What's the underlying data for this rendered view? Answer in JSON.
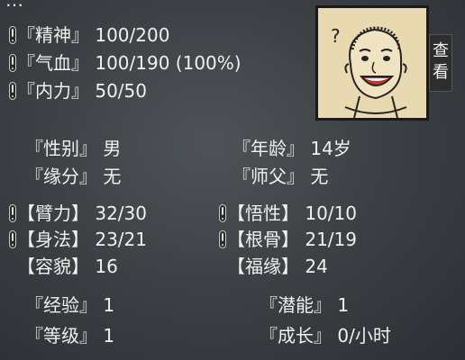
{
  "top_text": "…",
  "vitals": [
    {
      "label": "『精神』",
      "value": "100/200",
      "warn": true
    },
    {
      "label": "『气血』",
      "value": "100/190 (100%)",
      "warn": true
    },
    {
      "label": "『内力』",
      "value": "50/50",
      "warn": true
    }
  ],
  "info": {
    "gender_label": "『性别』",
    "gender": "男",
    "age_label": "『年龄』",
    "age": "14岁",
    "fate_label": "『缘分』",
    "fate": "无",
    "master_label": "『师父』",
    "master": "无"
  },
  "attributes": {
    "strength_label": "【臂力】",
    "strength": "32/30",
    "agility_label": "【身法】",
    "agility": "23/21",
    "looks_label": "【容貌】",
    "looks": "16",
    "insight_label": "【悟性】",
    "insight": "10/10",
    "bones_label": "【根骨】",
    "bones": "21/19",
    "luck_label": "【福缘】",
    "luck": "24"
  },
  "progress": {
    "exp_label": "『经验』",
    "exp": "1",
    "potential_label": "『潜能』",
    "potential": "1",
    "level_label": "『等级』",
    "level": "1",
    "growth_label": "『成长』",
    "growth": "0/小时"
  },
  "portrait": {
    "view_label": "查看"
  }
}
